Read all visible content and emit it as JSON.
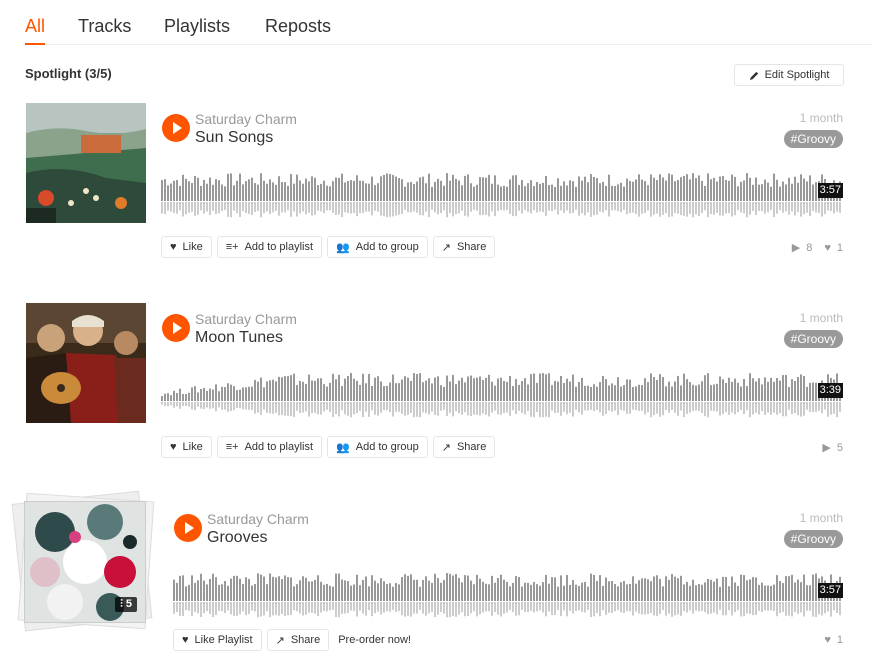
{
  "tabs": [
    "All",
    "Tracks",
    "Playlists",
    "Reposts"
  ],
  "spotlight": {
    "title": "Spotlight (3/5)",
    "edit_label": "Edit Spotlight"
  },
  "tracks": [
    {
      "artist": "Saturday Charm",
      "title": "Sun Songs",
      "age": "1 month",
      "tag": "#Groovy",
      "duration": "3:57",
      "actions": [
        "Like",
        "Add to playlist",
        "Add to group",
        "Share"
      ],
      "plays": "8",
      "likes": "1",
      "art_icon": "painting-landscape"
    },
    {
      "artist": "Saturday Charm",
      "title": "Moon Tunes",
      "age": "1 month",
      "tag": "#Groovy",
      "duration": "3:39",
      "actions": [
        "Like",
        "Add to playlist",
        "Add to group",
        "Share"
      ],
      "plays": "5",
      "art_icon": "painting-musicians"
    },
    {
      "artist": "Saturday Charm",
      "title": "Grooves",
      "age": "1 month",
      "tag": "#Groovy",
      "duration": "3:57",
      "actions": [
        "Like Playlist",
        "Share"
      ],
      "preorder": "Pre-order now!",
      "likes": "1",
      "track_count": "5",
      "art_icon": "abstract-floral-playlist"
    }
  ],
  "colors": {
    "accent": "#ff5500",
    "wave": "#999999",
    "wave_reflection": "#cccccc",
    "tag_bg": "#999999"
  }
}
